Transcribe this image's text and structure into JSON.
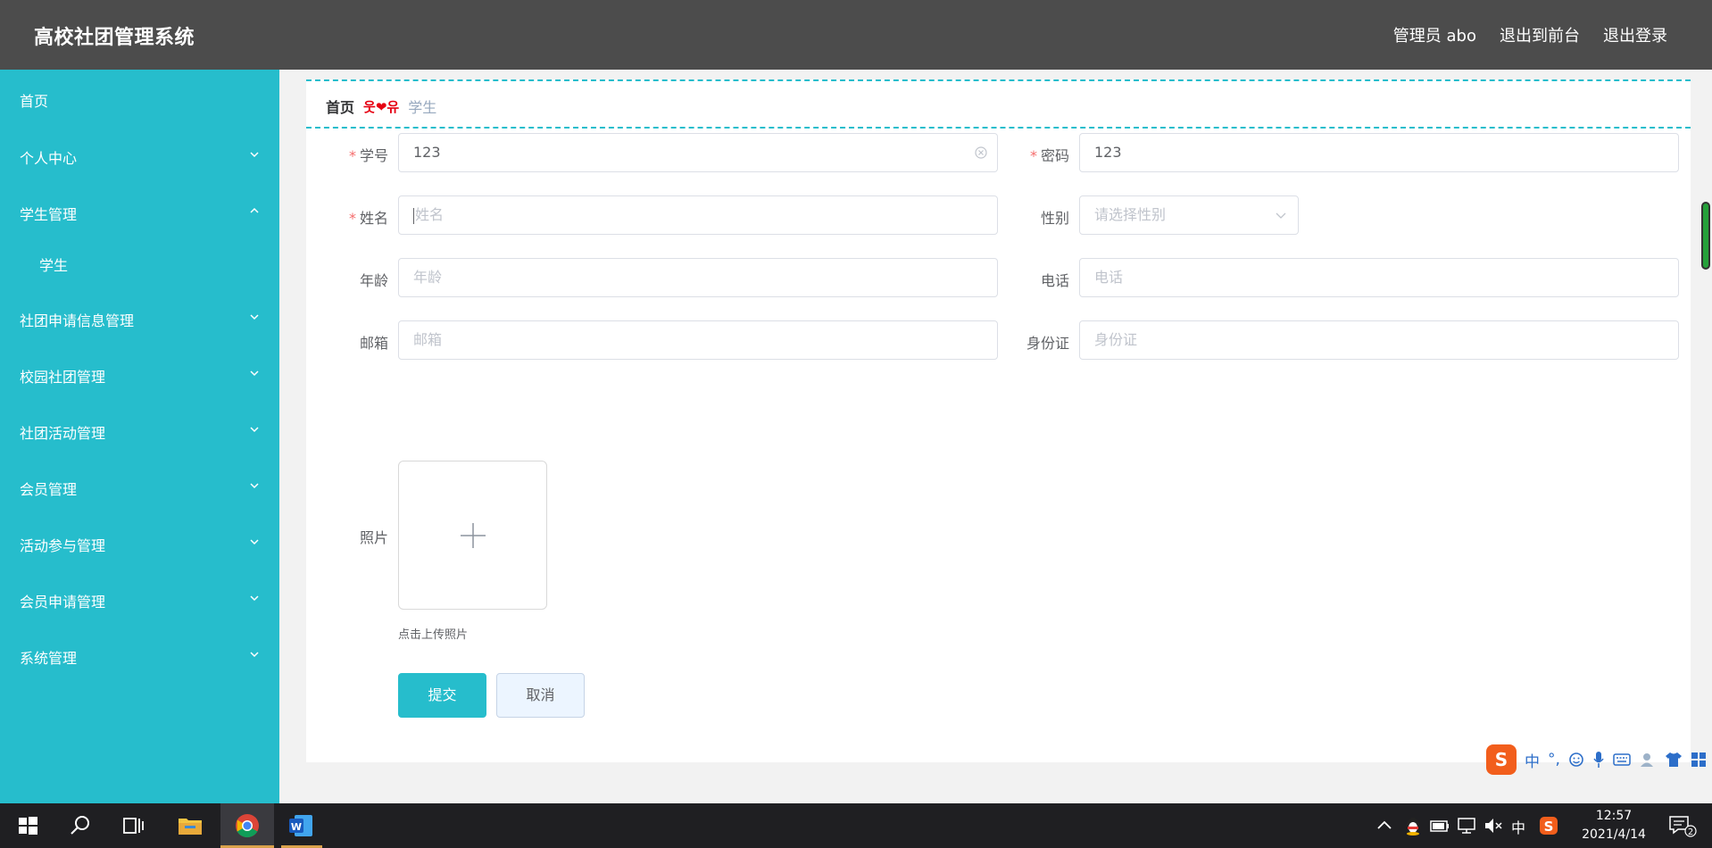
{
  "header": {
    "title": "高校社团管理系统",
    "actions": [
      "管理员 abo",
      "退出到前台",
      "退出登录"
    ]
  },
  "sidebar": {
    "items": [
      {
        "label": "首页",
        "has_chevron": false
      },
      {
        "label": "个人中心",
        "has_chevron": true
      },
      {
        "label": "学生管理",
        "has_chevron": true,
        "expanded": true
      },
      {
        "label": "学生",
        "sub": true
      },
      {
        "label": "社团申请信息管理",
        "has_chevron": true
      },
      {
        "label": "校园社团管理",
        "has_chevron": true
      },
      {
        "label": "社团活动管理",
        "has_chevron": true
      },
      {
        "label": "会员管理",
        "has_chevron": true
      },
      {
        "label": "活动参与管理",
        "has_chevron": true
      },
      {
        "label": "会员申请管理",
        "has_chevron": true
      },
      {
        "label": "系统管理",
        "has_chevron": true
      }
    ]
  },
  "breadcrumb": {
    "home": "首页",
    "separator": "웃❤유",
    "current": "学生"
  },
  "form": {
    "student_id": {
      "label": "学号",
      "required": true,
      "value": "123"
    },
    "password": {
      "label": "密码",
      "required": true,
      "value": "123"
    },
    "name": {
      "label": "姓名",
      "required": true,
      "placeholder": "姓名"
    },
    "gender": {
      "label": "性别",
      "placeholder": "请选择性别"
    },
    "age": {
      "label": "年龄",
      "placeholder": "年龄"
    },
    "phone": {
      "label": "电话",
      "placeholder": "电话"
    },
    "email": {
      "label": "邮箱",
      "placeholder": "邮箱"
    },
    "id_card": {
      "label": "身份证",
      "placeholder": "身份证"
    },
    "photo": {
      "label": "照片",
      "tip": "点击上传照片"
    },
    "submit": "提交",
    "cancel": "取消"
  },
  "ime": {
    "logo": "S",
    "mode": "中",
    "punct": "°,"
  },
  "taskbar": {
    "tray_lang": "中",
    "time": "12:57",
    "date": "2021/4/14",
    "notifications": "2"
  },
  "colors": {
    "accent": "#26bdcc",
    "header": "#4c4c4c",
    "required": "#f56c6c"
  }
}
